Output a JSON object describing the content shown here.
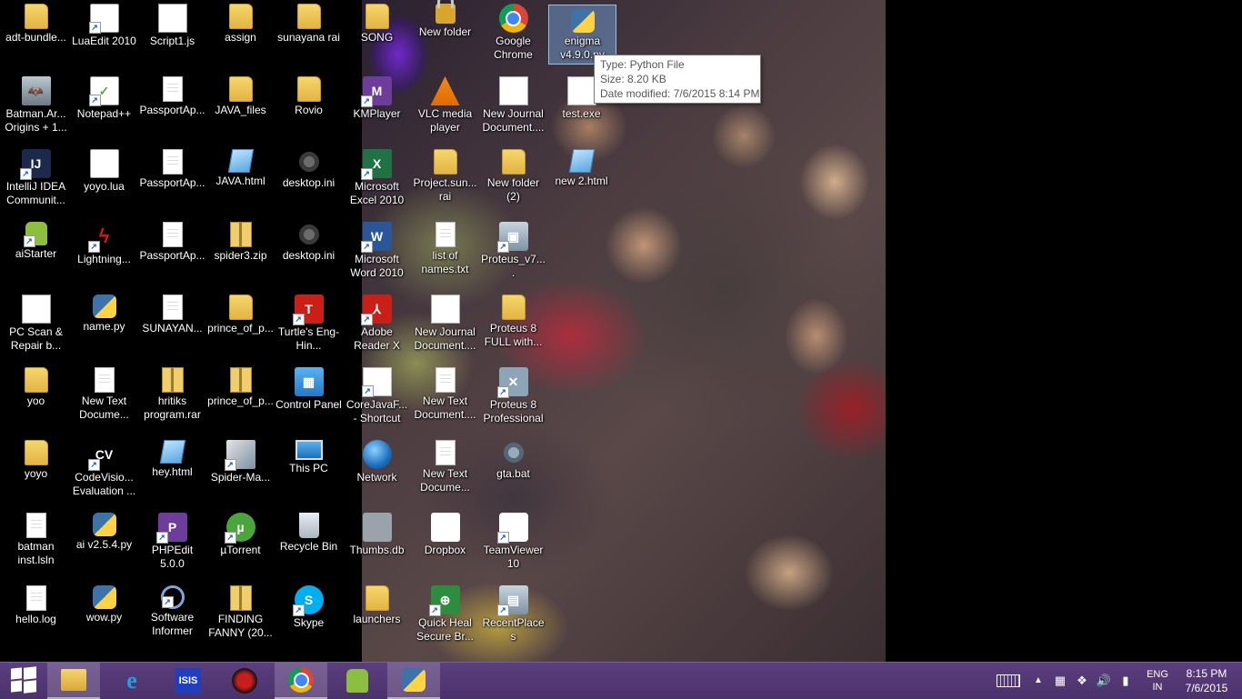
{
  "desktop": {
    "icons": [
      {
        "label": "adt-bundle...",
        "icon": "folder-icon"
      },
      {
        "label": "LuaEdit 2010",
        "icon": "luaedit-icon"
      },
      {
        "label": "Script1.js",
        "icon": "js-file-icon"
      },
      {
        "label": "assign",
        "icon": "folder-icon"
      },
      {
        "label": "sunayana rai",
        "icon": "user-folder-icon"
      },
      {
        "label": "SONG",
        "icon": "folder-icon"
      },
      {
        "label": "New folder",
        "icon": "lock-folder-icon"
      },
      {
        "label": "Google Chrome",
        "icon": "chrome-icon"
      },
      {
        "label": "enigma v4.9.0.py",
        "icon": "python-file-icon"
      },
      {
        "label": "Batman.Ar... Origins + 1...",
        "icon": "batman-icon"
      },
      {
        "label": "Notepad++",
        "icon": "notepadpp-icon"
      },
      {
        "label": "PassportAp...",
        "icon": "document-icon"
      },
      {
        "label": "JAVA_files",
        "icon": "folder-icon"
      },
      {
        "label": "Rovio",
        "icon": "folder-icon"
      },
      {
        "label": "KMPlayer",
        "icon": "kmplayer-icon"
      },
      {
        "label": "VLC media player",
        "icon": "vlc-icon"
      },
      {
        "label": "New Journal Document....",
        "icon": "journal-icon"
      },
      {
        "label": "test.exe",
        "icon": "exe-icon"
      },
      {
        "label": "IntelliJ IDEA Communit...",
        "icon": "intellij-icon"
      },
      {
        "label": "yoyo.lua",
        "icon": "lua-file-icon"
      },
      {
        "label": "PassportAp...",
        "icon": "document-icon"
      },
      {
        "label": "JAVA.html",
        "icon": "html-file-icon"
      },
      {
        "label": "desktop.ini",
        "icon": "settings-file-icon"
      },
      {
        "label": "Microsoft Excel 2010",
        "icon": "excel-icon"
      },
      {
        "label": "Project.sun... rai",
        "icon": "folder-icon"
      },
      {
        "label": "New folder (2)",
        "icon": "folder-icon"
      },
      {
        "label": "new 2.html",
        "icon": "html-file-icon"
      },
      {
        "label": "aiStarter",
        "icon": "aistarter-icon"
      },
      {
        "label": "Lightning...",
        "icon": "lightning-icon"
      },
      {
        "label": "PassportAp...",
        "icon": "document-icon"
      },
      {
        "label": "spider3.zip",
        "icon": "zip-file-icon"
      },
      {
        "label": "desktop.ini",
        "icon": "settings-file-icon"
      },
      {
        "label": "Microsoft Word 2010",
        "icon": "word-icon"
      },
      {
        "label": "list of names.txt",
        "icon": "text-file-icon"
      },
      {
        "label": "Proteus_v7....",
        "icon": "proteus-icon"
      },
      {
        "label": "PC Scan & Repair b...",
        "icon": "pcscan-icon"
      },
      {
        "label": "name.py",
        "icon": "python-file-icon"
      },
      {
        "label": "SUNAYAN...",
        "icon": "document-icon"
      },
      {
        "label": "prince_of_p...",
        "icon": "folder-icon"
      },
      {
        "label": "Turtle's Eng-Hin...",
        "icon": "turtle-icon"
      },
      {
        "label": "Adobe Reader X",
        "icon": "adobe-reader-icon"
      },
      {
        "label": "New Journal Document....",
        "icon": "journal-icon"
      },
      {
        "label": "Proteus 8 FULL with...",
        "icon": "folder-icon"
      },
      {
        "label": "yoo",
        "icon": "folder-icon"
      },
      {
        "label": "New Text Docume...",
        "icon": "text-file-icon"
      },
      {
        "label": "hritiks program.rar",
        "icon": "rar-file-icon"
      },
      {
        "label": "prince_of_p...",
        "icon": "zip-file-icon"
      },
      {
        "label": "Control Panel",
        "icon": "control-panel-icon"
      },
      {
        "label": "CoreJavaF... - Shortcut",
        "icon": "pdf-file-icon"
      },
      {
        "label": "New Text Document....",
        "icon": "text-file-icon"
      },
      {
        "label": "Proteus 8 Professional",
        "icon": "proteus-icon"
      },
      {
        "label": "yoyo",
        "icon": "folder-icon"
      },
      {
        "label": "CodeVisio... Evaluation ...",
        "icon": "codevision-icon"
      },
      {
        "label": "hey.html",
        "icon": "html-file-icon"
      },
      {
        "label": "Spider-Ma...",
        "icon": "spiderman-icon"
      },
      {
        "label": "This PC",
        "icon": "this-pc-icon"
      },
      {
        "label": "Network",
        "icon": "network-icon"
      },
      {
        "label": "New Text Docume...",
        "icon": "text-file-icon"
      },
      {
        "label": "gta.bat",
        "icon": "batch-file-icon"
      },
      {
        "label": "batman inst.lsln",
        "icon": "installer-icon"
      },
      {
        "label": "ai v2.5.4.py",
        "icon": "python-file-icon"
      },
      {
        "label": "PHPEdit 5.0.0",
        "icon": "phpedit-icon"
      },
      {
        "label": "µTorrent",
        "icon": "utorrent-icon"
      },
      {
        "label": "Recycle Bin",
        "icon": "recycle-bin-icon"
      },
      {
        "label": "Thumbs.db",
        "icon": "thumbs-db-icon"
      },
      {
        "label": "Dropbox",
        "icon": "dropbox-icon"
      },
      {
        "label": "TeamViewer 10",
        "icon": "teamviewer-icon"
      },
      {
        "label": "hello.log",
        "icon": "text-file-icon"
      },
      {
        "label": "wow.py",
        "icon": "python-file-icon"
      },
      {
        "label": "Software Informer",
        "icon": "software-informer-icon"
      },
      {
        "label": "FINDING FANNY (20...",
        "icon": "zip-file-icon"
      },
      {
        "label": "Skype",
        "icon": "skype-icon"
      },
      {
        "label": "launchers",
        "icon": "folder-icon"
      },
      {
        "label": "Quick Heal Secure Br...",
        "icon": "quickheal-icon"
      },
      {
        "label": "RecentPlaces",
        "icon": "recent-places-icon"
      }
    ]
  },
  "tooltip": {
    "type": "Type: Python File",
    "size": "Size: 8.20 KB",
    "modified": "Date modified: 7/6/2015 8:14 PM"
  },
  "taskbar": {
    "pinned": [
      {
        "name": "file-explorer-icon",
        "active": true
      },
      {
        "name": "internet-explorer-icon",
        "active": false
      },
      {
        "name": "isis-icon",
        "active": false
      },
      {
        "name": "spiderman-game-icon",
        "active": false
      },
      {
        "name": "chrome-icon",
        "active": true
      },
      {
        "name": "android-icon",
        "active": false
      },
      {
        "name": "python-icon",
        "active": true
      }
    ],
    "tray": {
      "keyboard": "keyboard-icon",
      "language_line1": "ENG",
      "language_line2": "IN",
      "time": "8:15 PM",
      "date": "7/6/2015"
    }
  },
  "colors": {
    "taskbar": "#4b326b",
    "tooltip_border": "#767676",
    "selection": "#78aae6"
  }
}
